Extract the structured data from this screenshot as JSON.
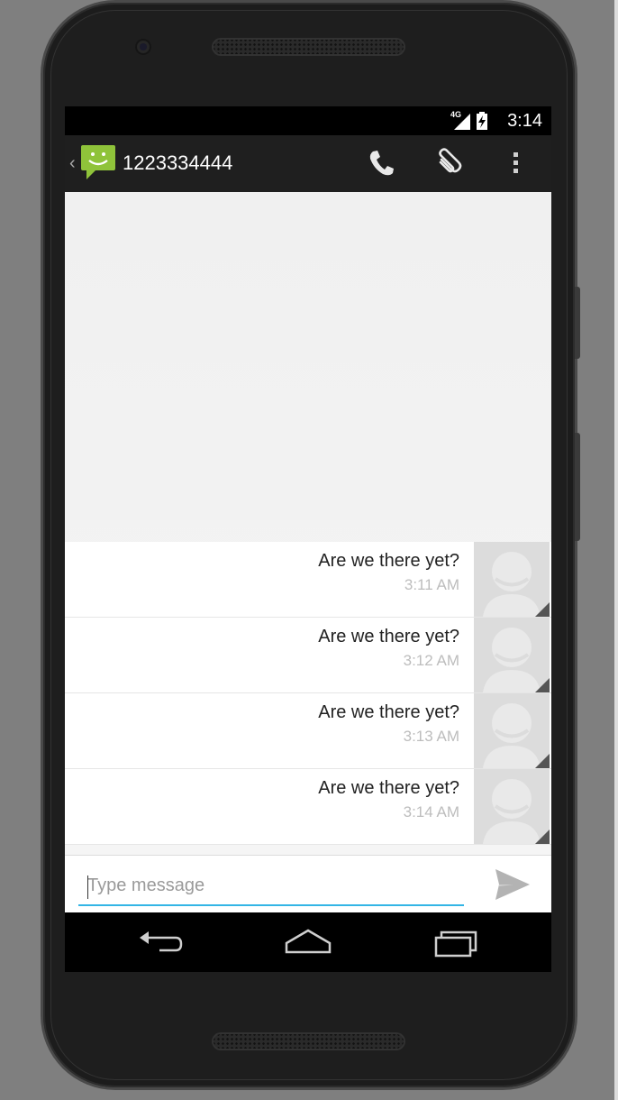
{
  "status_bar": {
    "network": "4G",
    "time": "3:14"
  },
  "app_bar": {
    "back_caret": "‹",
    "title": "1223334444",
    "icons": [
      "call-icon",
      "attach-icon",
      "overflow-menu-icon"
    ]
  },
  "messages": [
    {
      "text": "Are we there yet?",
      "time": "3:11 AM"
    },
    {
      "text": "Are we there yet?",
      "time": "3:12 AM"
    },
    {
      "text": "Are we there yet?",
      "time": "3:13 AM"
    },
    {
      "text": "Are we there yet?",
      "time": "3:14 AM"
    }
  ],
  "compose": {
    "placeholder": "Type message",
    "value": ""
  },
  "nav_bar": {
    "icons": [
      "back-icon",
      "home-icon",
      "recents-icon"
    ]
  },
  "colors": {
    "accent": "#33b5e5",
    "app_logo": "#8fc33a",
    "app_bar": "#1f1f1f"
  }
}
